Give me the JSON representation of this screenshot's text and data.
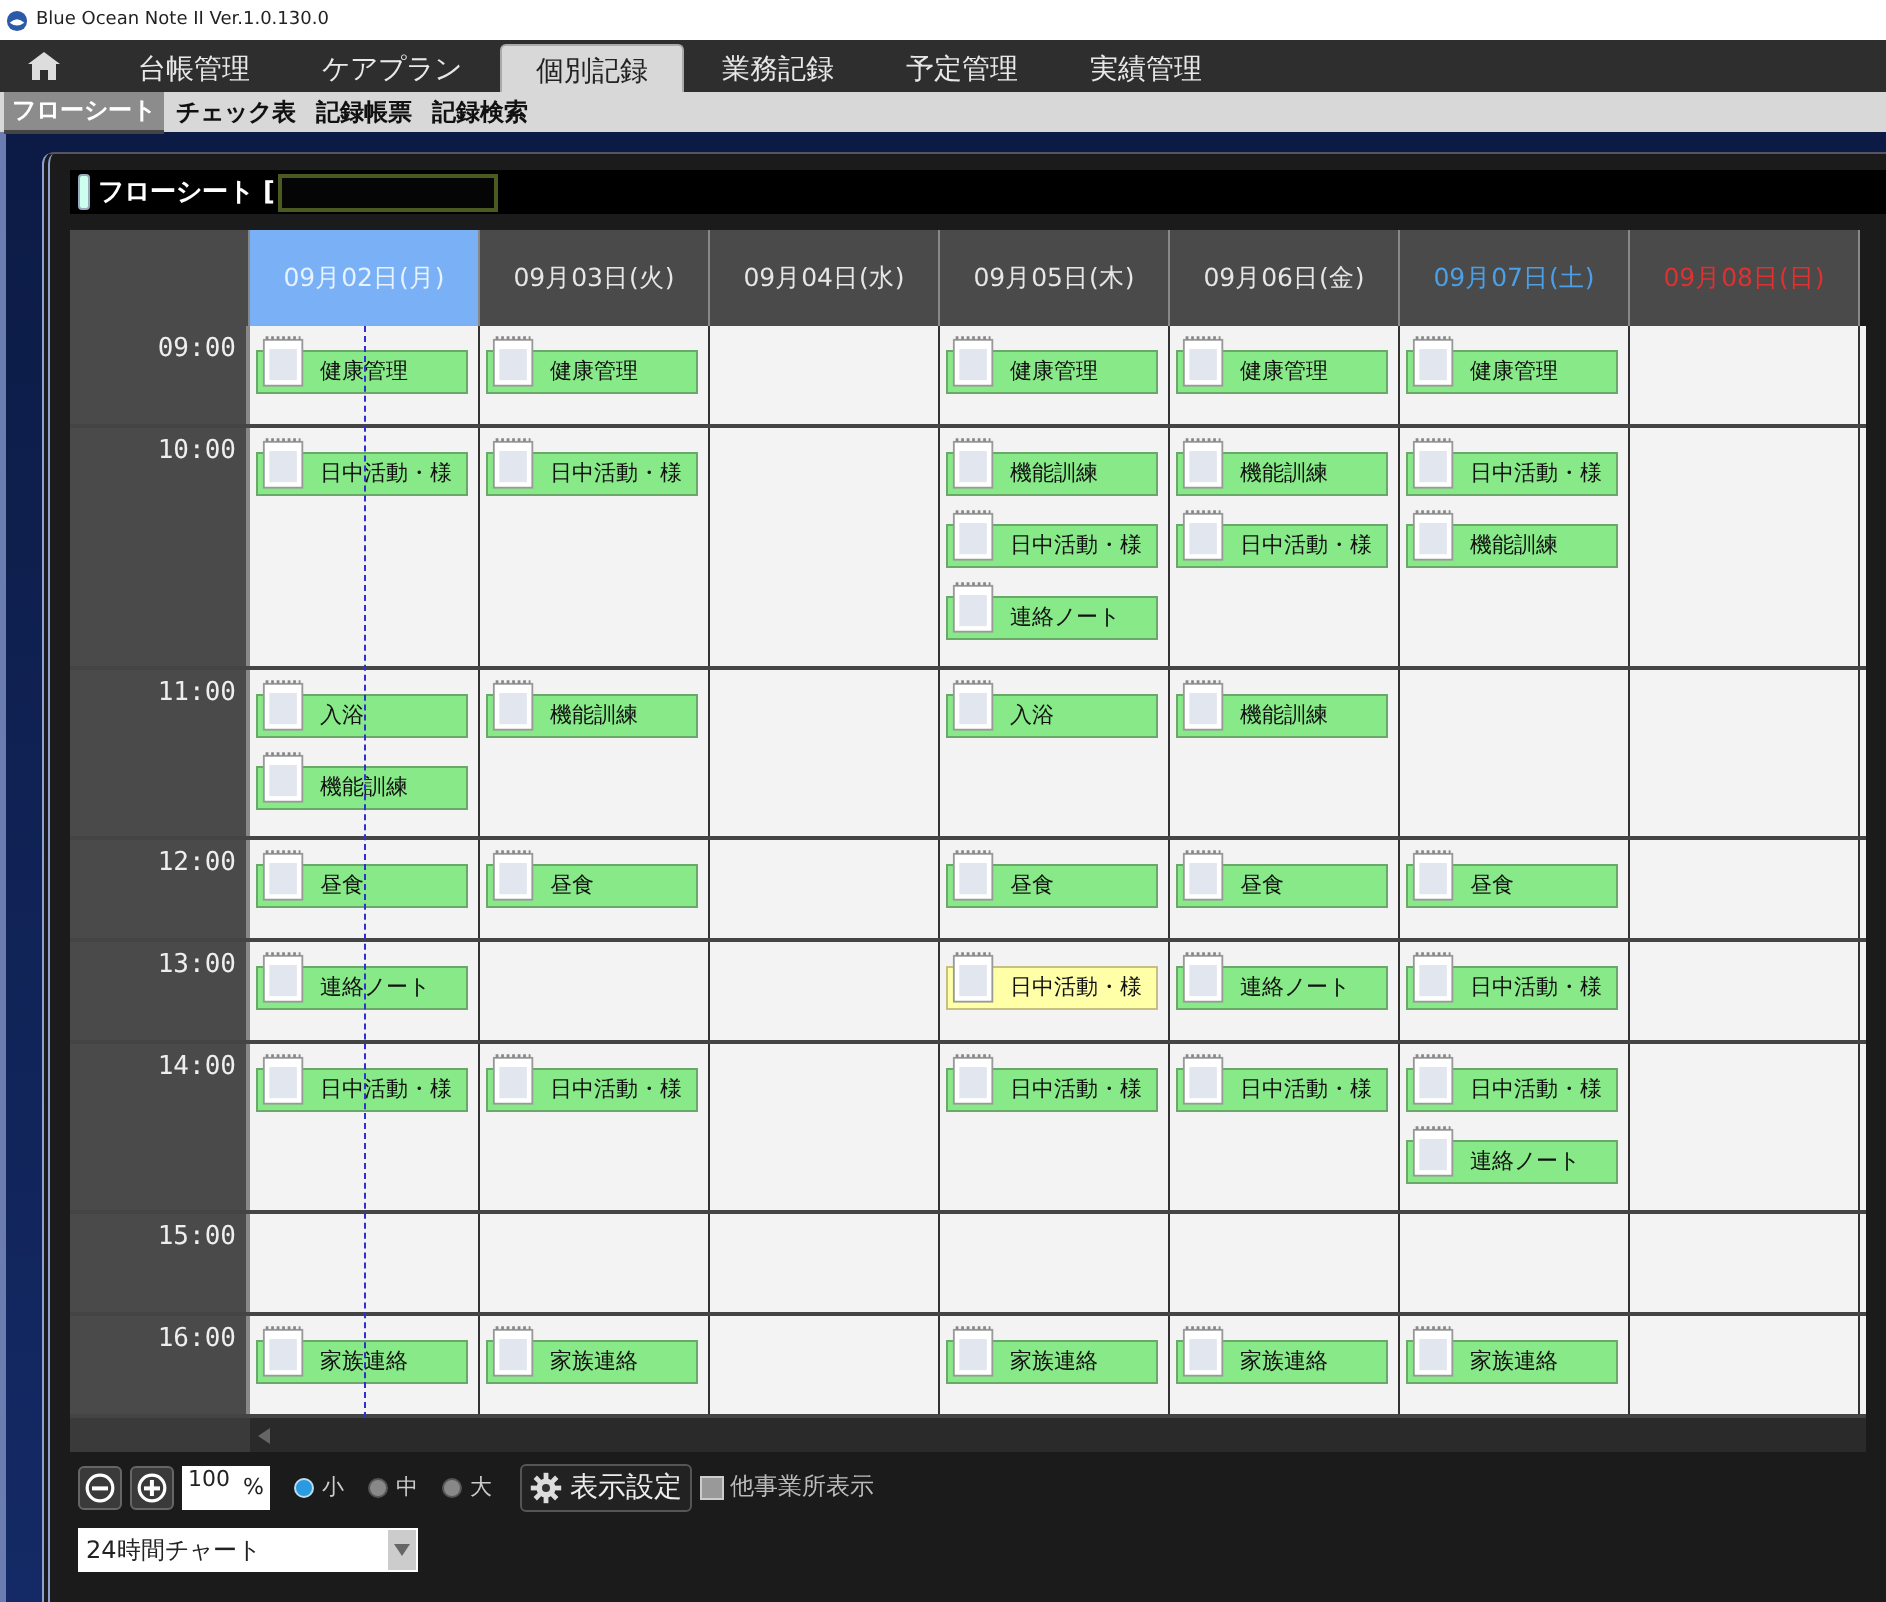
{
  "window": {
    "title": "Blue Ocean Note II  Ver.1.0.130.0"
  },
  "main_tabs": [
    {
      "label": "台帳管理",
      "selected": false
    },
    {
      "label": "ケアプラン",
      "selected": false
    },
    {
      "label": "個別記録",
      "selected": true
    },
    {
      "label": "業務記録",
      "selected": false
    },
    {
      "label": "予定管理",
      "selected": false
    },
    {
      "label": "実績管理",
      "selected": false
    }
  ],
  "sub_tabs": [
    {
      "label": "フローシート",
      "selected": true
    },
    {
      "label": "チェック表",
      "selected": false
    },
    {
      "label": "記録帳票",
      "selected": false
    },
    {
      "label": "記録検索",
      "selected": false
    }
  ],
  "panel": {
    "title": "フローシート ["
  },
  "columns": [
    {
      "label": "09月02日(月)",
      "color": "#e6f2ff",
      "selected": true
    },
    {
      "label": "09月03日(火)",
      "color": "#e6e6e6",
      "selected": false
    },
    {
      "label": "09月04日(水)",
      "color": "#e6e6e6",
      "selected": false
    },
    {
      "label": "09月05日(木)",
      "color": "#e6e6e6",
      "selected": false
    },
    {
      "label": "09月06日(金)",
      "color": "#e6e6e6",
      "selected": false
    },
    {
      "label": "09月07日(土)",
      "color": "#4aa0e8",
      "selected": false
    },
    {
      "label": "09月08日(日)",
      "color": "#e03030",
      "selected": false
    }
  ],
  "rows": [
    {
      "time": "09:00",
      "cells": [
        [
          {
            "label": "健康管理",
            "highlighted": false
          }
        ],
        [
          {
            "label": "健康管理",
            "highlighted": false
          }
        ],
        [],
        [
          {
            "label": "健康管理",
            "highlighted": false
          }
        ],
        [
          {
            "label": "健康管理",
            "highlighted": false
          }
        ],
        [
          {
            "label": "健康管理",
            "highlighted": false
          }
        ],
        []
      ]
    },
    {
      "time": "10:00",
      "cells": [
        [
          {
            "label": "日中活動・様",
            "highlighted": false
          }
        ],
        [
          {
            "label": "日中活動・様",
            "highlighted": false
          }
        ],
        [],
        [
          {
            "label": "機能訓練",
            "highlighted": false
          },
          {
            "label": "日中活動・様",
            "highlighted": false
          },
          {
            "label": "連絡ノート",
            "highlighted": false
          }
        ],
        [
          {
            "label": "機能訓練",
            "highlighted": false
          },
          {
            "label": "日中活動・様",
            "highlighted": false
          }
        ],
        [
          {
            "label": "日中活動・様",
            "highlighted": false
          },
          {
            "label": "機能訓練",
            "highlighted": false
          }
        ],
        []
      ]
    },
    {
      "time": "11:00",
      "cells": [
        [
          {
            "label": "入浴",
            "highlighted": false
          },
          {
            "label": "機能訓練",
            "highlighted": false
          }
        ],
        [
          {
            "label": "機能訓練",
            "highlighted": false
          }
        ],
        [],
        [
          {
            "label": "入浴",
            "highlighted": false
          }
        ],
        [
          {
            "label": "機能訓練",
            "highlighted": false
          }
        ],
        [],
        []
      ]
    },
    {
      "time": "12:00",
      "cells": [
        [
          {
            "label": "昼食",
            "highlighted": false
          }
        ],
        [
          {
            "label": "昼食",
            "highlighted": false
          }
        ],
        [],
        [
          {
            "label": "昼食",
            "highlighted": false
          }
        ],
        [
          {
            "label": "昼食",
            "highlighted": false
          }
        ],
        [
          {
            "label": "昼食",
            "highlighted": false
          }
        ],
        []
      ]
    },
    {
      "time": "13:00",
      "cells": [
        [
          {
            "label": "連絡ノート",
            "highlighted": false
          }
        ],
        [],
        [],
        [
          {
            "label": "日中活動・様",
            "highlighted": true
          }
        ],
        [
          {
            "label": "連絡ノート",
            "highlighted": false
          }
        ],
        [
          {
            "label": "日中活動・様",
            "highlighted": false
          }
        ],
        []
      ]
    },
    {
      "time": "14:00",
      "cells": [
        [
          {
            "label": "日中活動・様",
            "highlighted": false
          }
        ],
        [
          {
            "label": "日中活動・様",
            "highlighted": false
          }
        ],
        [],
        [
          {
            "label": "日中活動・様",
            "highlighted": false
          }
        ],
        [
          {
            "label": "日中活動・様",
            "highlighted": false
          }
        ],
        [
          {
            "label": "日中活動・様",
            "highlighted": false
          },
          {
            "label": "連絡ノート",
            "highlighted": false
          }
        ],
        []
      ]
    },
    {
      "time": "15:00",
      "cells": [
        [],
        [],
        [],
        [],
        [],
        [],
        []
      ]
    },
    {
      "time": "16:00",
      "cells": [
        [
          {
            "label": "家族連絡",
            "highlighted": false
          }
        ],
        [
          {
            "label": "家族連絡",
            "highlighted": false
          }
        ],
        [],
        [
          {
            "label": "家族連絡",
            "highlighted": false
          }
        ],
        [
          {
            "label": "家族連絡",
            "highlighted": false
          }
        ],
        [
          {
            "label": "家族連絡",
            "highlighted": false
          }
        ],
        []
      ]
    }
  ],
  "toolbar": {
    "zoom_value": "100",
    "zoom_unit": "%",
    "sizes": [
      {
        "label": "小",
        "selected": true
      },
      {
        "label": "中",
        "selected": false
      },
      {
        "label": "大",
        "selected": false
      }
    ],
    "settings_button": "表示設定",
    "other_offices": {
      "label": "他事業所表示",
      "checked": false
    }
  },
  "chart_select": {
    "value": "24時間チャート"
  }
}
